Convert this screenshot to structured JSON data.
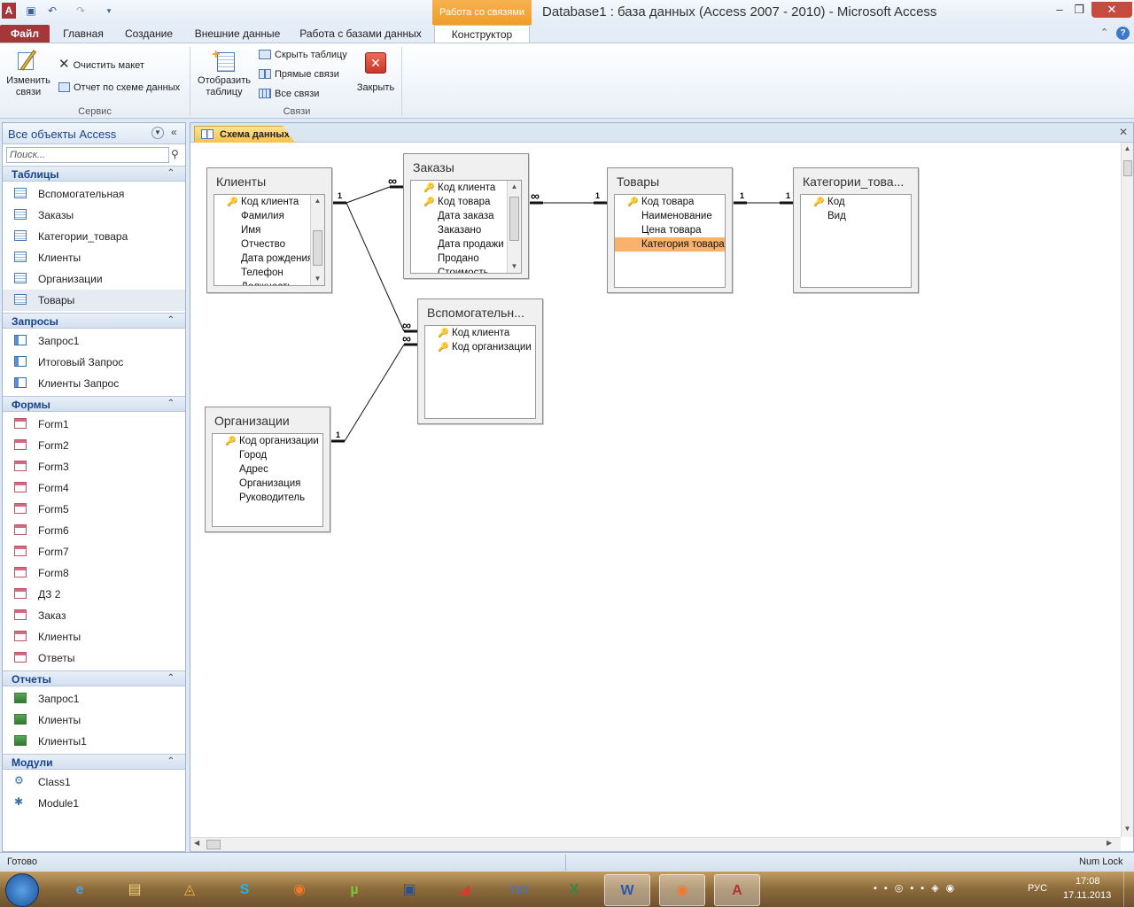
{
  "window": {
    "title": "Database1 : база данных (Access 2007 - 2010)  -  Microsoft Access",
    "context_tab_header": "Работа со связями"
  },
  "ribbon_tabs": [
    "Файл",
    "Главная",
    "Создание",
    "Внешние данные",
    "Работа с базами данных",
    "Конструктор"
  ],
  "ribbon": {
    "edit_relations": "Изменить\nсвязи",
    "clear_layout": "Очистить макет",
    "relation_report": "Отчет по схеме данных",
    "group_service": "Сервис",
    "show_table": "Отобразить\nтаблицу",
    "hide_table": "Скрыть таблицу",
    "direct_relations": "Прямые связи",
    "all_relations": "Все связи",
    "close": "Закрыть",
    "group_relations": "Связи"
  },
  "nav": {
    "title": "Все объекты Access",
    "search_placeholder": "Поиск...",
    "sections": [
      {
        "label": "Таблицы",
        "kind": "table",
        "items": [
          "Вспомогательная",
          "Заказы",
          "Категории_товара",
          "Клиенты",
          "Организации",
          "Товары"
        ]
      },
      {
        "label": "Запросы",
        "kind": "query",
        "items": [
          "Запрос1",
          "Итоговый Запрос",
          "Клиенты Запрос"
        ]
      },
      {
        "label": "Формы",
        "kind": "form",
        "items": [
          "Form1",
          "Form2",
          "Form3",
          "Form4",
          "Form5",
          "Form6",
          "Form7",
          "Form8",
          "ДЗ 2",
          "Заказ",
          "Клиенты",
          "Ответы"
        ]
      },
      {
        "label": "Отчеты",
        "kind": "report",
        "items": [
          "Запрос1",
          "Клиенты",
          "Клиенты1"
        ]
      },
      {
        "label": "Модули",
        "kind": "module",
        "items": [
          "Class1",
          "Module1"
        ]
      }
    ],
    "selected_item": "Товары"
  },
  "document": {
    "tab_label": "Схема данных",
    "tables": [
      {
        "id": "klienty",
        "title": "Клиенты",
        "fields": [
          "Код клиента",
          "Фамилия",
          "Имя",
          "Отчество",
          "Дата рождения",
          "Телефон",
          "Должность"
        ],
        "keys": [
          0
        ]
      },
      {
        "id": "zakazy",
        "title": "Заказы",
        "fields": [
          "Код клиента",
          "Код товара",
          "Дата заказа",
          "Заказано",
          "Дата продажи",
          "Продано",
          "Стоимость"
        ],
        "keys": [
          0,
          1
        ]
      },
      {
        "id": "tovary",
        "title": "Товары",
        "fields": [
          "Код товара",
          "Наименование",
          "Цена товара",
          "Категория товара"
        ],
        "keys": [
          0
        ],
        "selected": 3
      },
      {
        "id": "kategorii",
        "title": "Категории_това...",
        "fields": [
          "Код",
          "Вид"
        ],
        "keys": [
          0
        ]
      },
      {
        "id": "vspom",
        "title": "Вспомогательн...",
        "fields": [
          "Код клиента",
          "Код организации"
        ],
        "keys": [
          0,
          1
        ]
      },
      {
        "id": "org",
        "title": "Организации",
        "fields": [
          "Код организации",
          "Город",
          "Адрес",
          "Организация",
          "Руководитель"
        ],
        "keys": [
          0
        ]
      }
    ],
    "relation_labels": {
      "one": "1",
      "many": "∞"
    }
  },
  "status": {
    "left": "Готово",
    "right": "Num Lock"
  },
  "taskbar": {
    "time": "17:08",
    "date": "17.11.2013",
    "lang": "РУС"
  }
}
